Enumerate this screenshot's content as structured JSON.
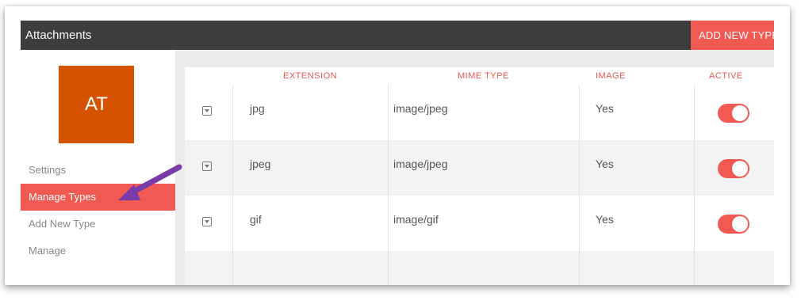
{
  "header": {
    "title": "Attachments",
    "add_button_label": "ADD NEW TYPE"
  },
  "sidebar": {
    "avatar_initials": "AT",
    "avatar_color": "#d55300",
    "items": [
      {
        "label": "Settings",
        "active": false
      },
      {
        "label": "Manage Types",
        "active": true
      },
      {
        "label": "Add New Type",
        "active": false
      },
      {
        "label": "Manage",
        "active": false
      }
    ]
  },
  "table": {
    "columns": [
      "EXTENSION",
      "MIME TYPE",
      "IMAGE",
      "ACTIVE"
    ],
    "rows": [
      {
        "extension": "jpg",
        "mime_type": "image/jpeg",
        "image": "Yes",
        "active": true
      },
      {
        "extension": "jpeg",
        "mime_type": "image/jpeg",
        "image": "Yes",
        "active": true
      },
      {
        "extension": "gif",
        "mime_type": "image/gif",
        "image": "Yes",
        "active": true
      }
    ]
  },
  "colors": {
    "accent": "#f15a52",
    "topbar": "#3d3d3d",
    "annotation_arrow": "#7a3aa8"
  }
}
